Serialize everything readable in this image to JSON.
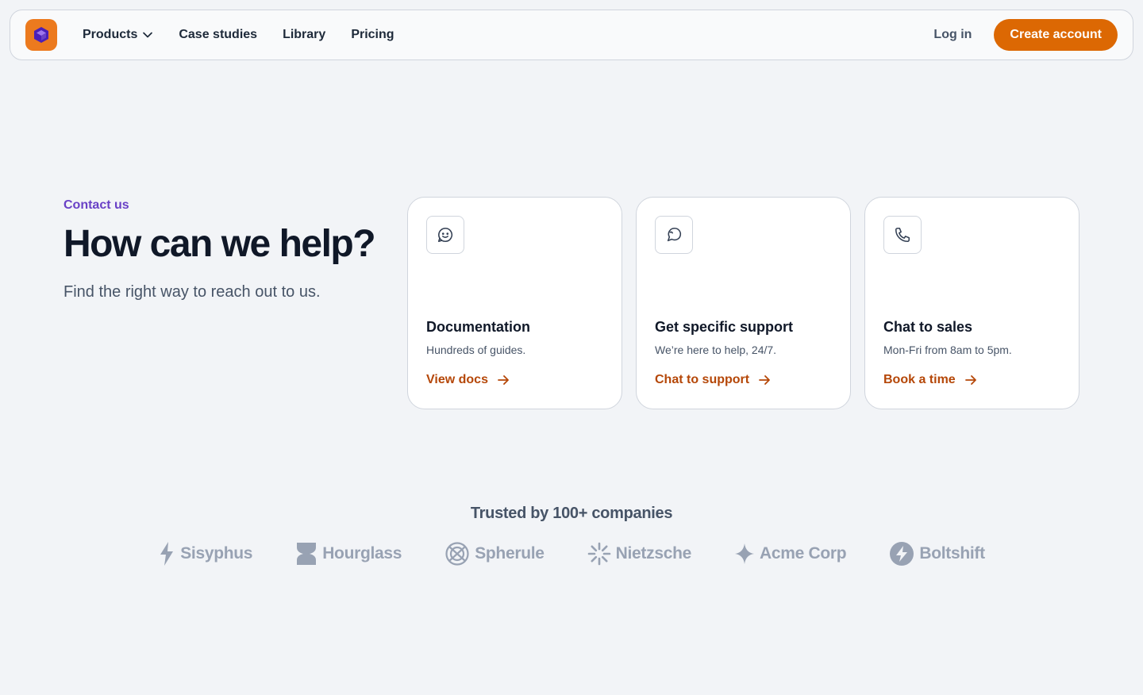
{
  "nav": {
    "links": [
      {
        "label": "Products"
      },
      {
        "label": "Case studies"
      },
      {
        "label": "Library"
      },
      {
        "label": "Pricing"
      }
    ],
    "login_label": "Log in",
    "cta_label": "Create account"
  },
  "hero": {
    "eyebrow": "Contact us",
    "title": "How can we help?",
    "subtitle": "Find the right way to reach out to us."
  },
  "cards": [
    {
      "icon": "smile-chat-icon",
      "title": "Documentation",
      "description": "Hundreds of guides.",
      "link": "View docs"
    },
    {
      "icon": "message-icon",
      "title": "Get specific support",
      "description": "We’re here to help, 24/7.",
      "link": "Chat to support"
    },
    {
      "icon": "phone-icon",
      "title": "Chat to sales",
      "description": "Mon-Fri from 8am to 5pm.",
      "link": "Book a time"
    }
  ],
  "trusted": {
    "heading": "Trusted by 100+ companies",
    "logos": [
      {
        "name": "Sisyphus",
        "icon": "bolt-icon"
      },
      {
        "name": "Hourglass",
        "icon": "hourglass-icon"
      },
      {
        "name": "Spherule",
        "icon": "sphere-icon"
      },
      {
        "name": "Nietzsche",
        "icon": "burst-icon"
      },
      {
        "name": "Acme Corp",
        "icon": "sparkle-icon"
      },
      {
        "name": "Boltshift",
        "icon": "circle-bolt-icon"
      }
    ]
  },
  "colors": {
    "accent": "#dc6803",
    "link": "#b54708",
    "eyebrow": "#6941c6",
    "background": "#f2f4f7",
    "logo_bg": "#ec7a1e"
  }
}
